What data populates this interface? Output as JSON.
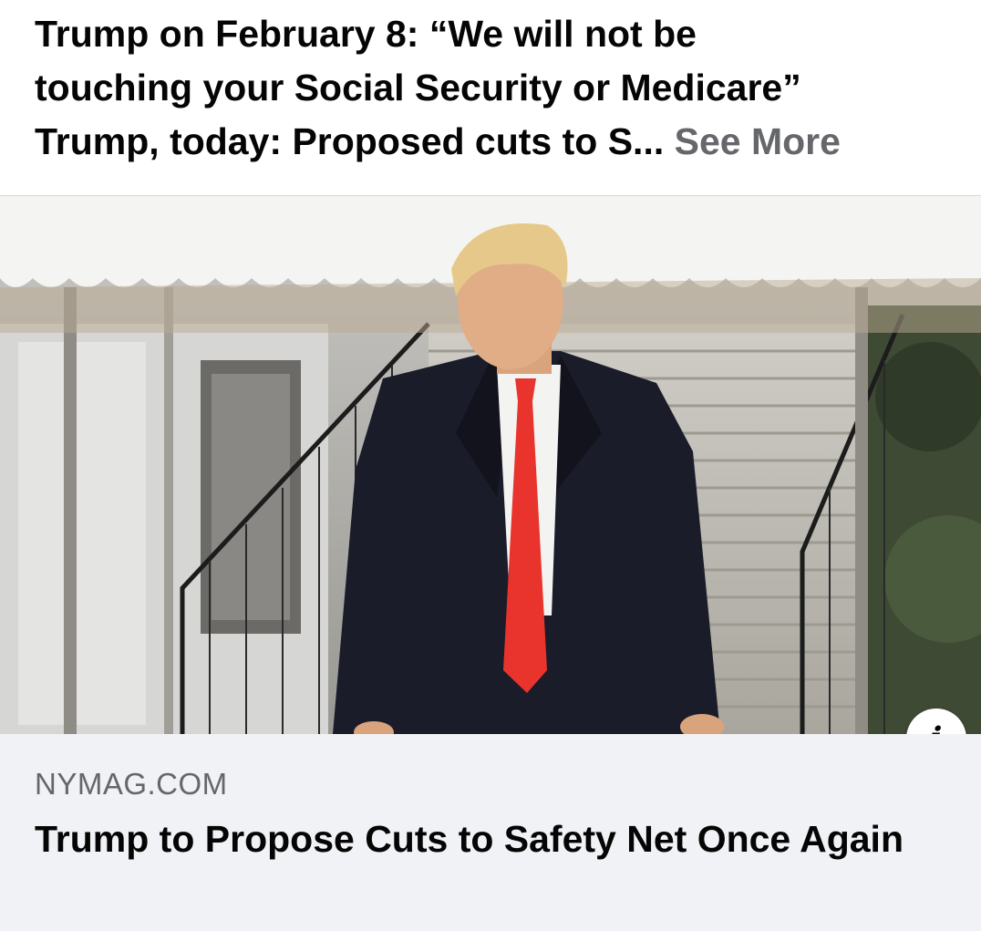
{
  "post": {
    "text_lines": [
      "Trump on February 8: “We will not be",
      "touching your Social Security or Medicare”",
      "Trump, today: Proposed cuts to S... "
    ],
    "see_more_label": "See More"
  },
  "link_preview": {
    "image_alt": "Photo of Donald Trump in a dark overcoat and red tie walking outside the White House",
    "info_icon": "info-icon",
    "info_glyph": "i",
    "domain": "NYMAG.COM",
    "title": "Trump to Propose Cuts to Safety Net Once Again"
  },
  "colors": {
    "text": "#050505",
    "secondary_text": "#65676b",
    "card_background": "#f0f2f5",
    "tie_red": "#e8342c",
    "coat_navy": "#1a1c2a"
  }
}
